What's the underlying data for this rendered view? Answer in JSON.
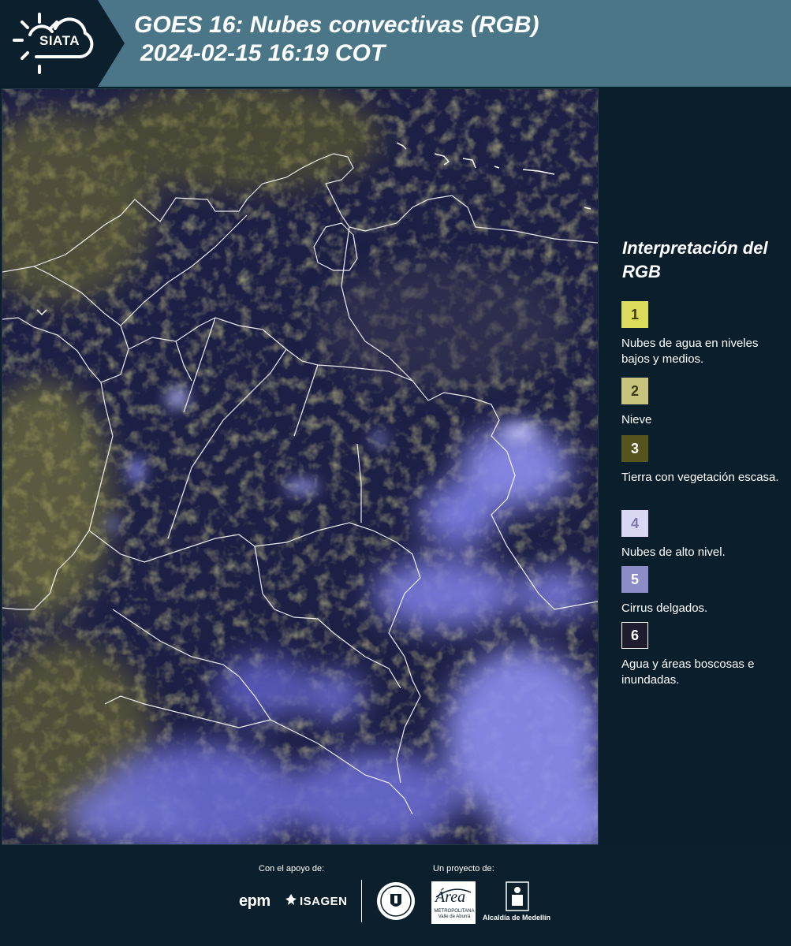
{
  "header": {
    "logo_text": "SIATA",
    "title_line1": "GOES 16: Nubes convectivas (RGB)",
    "title_line2": "2024-02-15 16:19 COT",
    "bg_color": "#4a7688",
    "logo_bg_color": "#0b1f2c"
  },
  "map": {
    "icon": "satellite-map-image",
    "colors": {
      "background": "#1d1f45",
      "low_clouds": "#8e8a3a",
      "high_clouds": "#8d8ff0",
      "borders": "#ffffff"
    }
  },
  "legend": {
    "title": "Interpretación del RGB",
    "items": [
      {
        "number": "1",
        "label": "Nubes de agua en niveles bajos y medios.",
        "color": "#dcdc5c",
        "text_color": "#3a3a10"
      },
      {
        "number": "2",
        "label": "Nieve",
        "color": "#c8c47e",
        "text_color": "#3a3a10"
      },
      {
        "number": "3",
        "label": "Tierra con vegetación escasa.",
        "color": "#55541e",
        "text_color": "#ffffff"
      },
      {
        "number": "4",
        "label": "Nubes de alto nivel.",
        "color": "#d8d8f2",
        "text_color": "#7a7ab0"
      },
      {
        "number": "5",
        "label": "Cirrus delgados.",
        "color": "#8c8cc8",
        "text_color": "#ffffff"
      },
      {
        "number": "6",
        "label": "Agua y áreas boscosas e inundadas.",
        "color": "#1e1c2e",
        "text_color": "#ffffff"
      }
    ]
  },
  "footer": {
    "support_label": "Con el apoyo de:",
    "project_label": "Un proyecto de:",
    "epm": "epm",
    "isagen": "ISAGEN",
    "area_logo": "Área",
    "area_sub": "METROPOLITANA Valle de Aburrá",
    "alcaldia": "Alcaldía de Medellín",
    "seal_icon": "medellin-seal-icon",
    "alcaldia_icon": "alcaldia-building-icon"
  }
}
